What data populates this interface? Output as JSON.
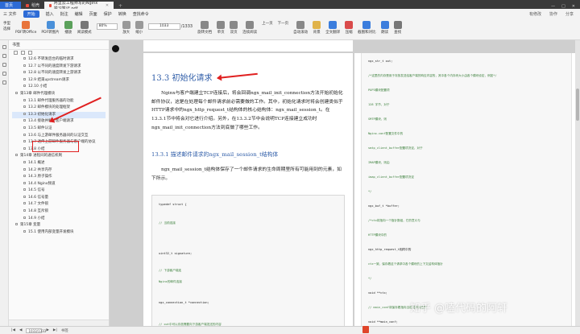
{
  "titlebar": {
    "tabs": [
      {
        "label": "首页"
      },
      {
        "label": "稻壳"
      },
      {
        "label": "阿里云工程师写的Nginx学习笔记.pdf"
      }
    ]
  },
  "menubar": {
    "file": "三 文件",
    "items": [
      "开始",
      "插入",
      "批注",
      "编辑",
      "页面",
      "保护",
      "转换"
    ],
    "search": "查找命令",
    "right": [
      "有修改",
      "协作",
      "分享"
    ]
  },
  "toolbar": {
    "left": [
      "手型",
      "选择"
    ],
    "buttons": [
      "PDF转Office",
      "PDF转图片",
      "播放",
      "阅读模式"
    ],
    "zoom": "80%",
    "zoom_buttons": [
      "放大",
      "缩小"
    ],
    "page_value": "1033",
    "page_total": "/1333",
    "rotate": [
      "旋转文档",
      "单页",
      "双页",
      "连续阅读"
    ],
    "nav": [
      "上一页",
      "下一页"
    ],
    "right": [
      "自动滚动",
      "背景",
      "全文翻译",
      "压缩",
      "截图和对比",
      "朗读",
      "查找"
    ],
    "translate": "划词翻译"
  },
  "sidebar": {
    "title": "书签",
    "items": [
      {
        "label": "12.6 不转发后台的临时请求",
        "level": 2
      },
      {
        "label": "12.7 以不同的速度转发下游请求",
        "level": 2
      },
      {
        "label": "12.8 以不同的速度转发上游请求",
        "level": 2
      },
      {
        "label": "12.9 结束upstream请求",
        "level": 2
      },
      {
        "label": "12.10 小结",
        "level": 2
      },
      {
        "label": "第13章 邮件代理模块",
        "level": 1
      },
      {
        "label": "13.1 邮件代理服务器的功能",
        "level": 2
      },
      {
        "label": "13.2 邮件模块的处理框架",
        "level": 2
      },
      {
        "label": "13.3 初始化请求",
        "level": 2,
        "selected": true
      },
      {
        "label": "13.4 接收并解析客户端请求",
        "level": 2
      },
      {
        "label": "13.5 邮件认证",
        "level": 2
      },
      {
        "label": "13.6 与上游邮件服务器间的认证交互",
        "level": 2
      },
      {
        "label": "13.7 透传上游邮件服务器与客户端的协议",
        "level": 2
      },
      {
        "label": "13.8 小结",
        "level": 2
      },
      {
        "label": "第14章 进程间的通信机制",
        "level": 1
      },
      {
        "label": "14.1 概述",
        "level": 2
      },
      {
        "label": "14.2 共享内存",
        "level": 2
      },
      {
        "label": "14.3 原子操作",
        "level": 2
      },
      {
        "label": "14.4 Nginx频道",
        "level": 2
      },
      {
        "label": "14.5 信号",
        "level": 2
      },
      {
        "label": "14.6 信号量",
        "level": 2
      },
      {
        "label": "14.7 文件锁",
        "level": 2
      },
      {
        "label": "14.8 互斥锁",
        "level": 2
      },
      {
        "label": "14.9 小结",
        "level": 2
      },
      {
        "label": "第15章 变量",
        "level": 1
      },
      {
        "label": "15.1 使用内部变量开发模块",
        "level": 2
      }
    ]
  },
  "page1": {
    "heading": "13.3  初始化请求",
    "para1": "Nginx与客户端建立TCP连接后，将会回调ngx_mail_init_connection方法开始初始化邮件协议，这是在处理每个邮件请求前必需要做的工作。其中，初始化请求时将会创建类似于HTTP请求中的ngx_http_request_t结构体的核心结构体：ngx_mail_session_t。在13.3.1节中将会对它进行介绍。另外，在13.3.2节中会说明TCP连接建立成功时ngx_mail_init_connection方法到底做了哪些工作。",
    "sub": "13.3.1  描述邮件请求的ngx_mail_session_t结构体",
    "para2": "ngx_mail_session_t结构体保存了一个邮件请求的生命周期里所有可能用到的元素，如下所示。",
    "code": [
      {
        "t": "typedef struct {",
        "k": "k"
      },
      {
        "t": "// 当前连接",
        "k": "c"
      },
      {
        "t": "uint32_t    signature;",
        "k": "k"
      },
      {
        "t": "// 下游客户端连",
        "k": "c"
      },
      {
        "t": "Nginx的邮件连接",
        "k": "c"
      },
      {
        "t": "ngx_connection_t   *connection;",
        "k": "k"
      },
      {
        "t": "// out中可以存放需要向下游客户端发送的内容",
        "k": "c"
      }
    ]
  },
  "page2": {
    "lines": [
      "ngx_str_t  out;",
      "/*这里的内存是用于存放发送给客户端的响应内容的，其中各个内存块大小由各个模块设定，例如*/",
      "POP3模块配置项",
      "128  字节，对于",
      "SMTP模块，则",
      "Nginx.conf配置文件中的",
      "smtp_client_buffer配置项决定，对于",
      "IMAP模块，则由",
      "imap_client_buffer配置项决定",
      "*/",
      "ngx_buf_t  *buffer;",
      "/*ctx将指向一个指针数组，它的意义与",
      "HTTP模块中的",
      "ngx_http_request_t相同中的",
      "ctx一致，保存着这个请求中各个模块的上下文结构体指针",
      "*/",
      "void  **ctx;",
      "// main_conf将保存着指向当前请求对应的",
      "void  **main_conf;"
    ]
  },
  "statusbar": {
    "page": "1033/1333",
    "view": "书签"
  },
  "watermark": "知乎 @嗑代码的阿轩"
}
